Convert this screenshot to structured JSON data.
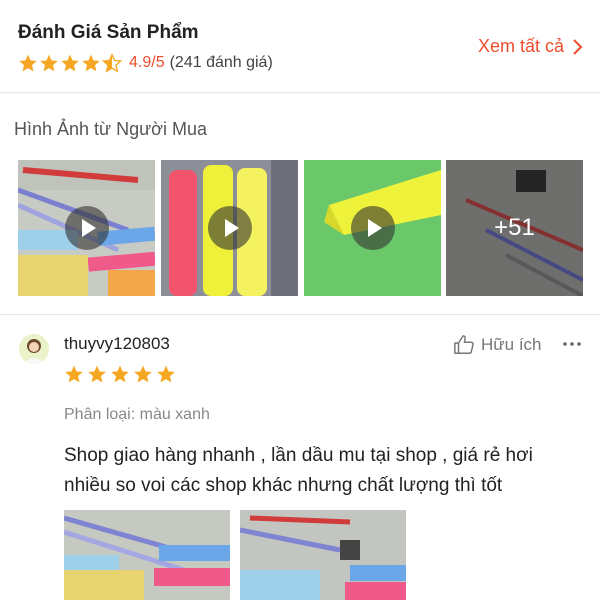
{
  "ratings": {
    "title": "Đánh Giá Sản Phẩm",
    "score": "4.9/5",
    "count": "(241 đánh giá)",
    "star_color": "#f5a623",
    "see_all": "Xem tất cả",
    "accent": "#ee4d2d"
  },
  "buyer_photos": {
    "title": "Hình Ảnh từ Người Mua",
    "items": [
      {
        "kind": "video",
        "icon": "play-icon"
      },
      {
        "kind": "video",
        "icon": "play-icon"
      },
      {
        "kind": "video",
        "icon": "play-icon"
      },
      {
        "kind": "more",
        "label": "+51"
      }
    ]
  },
  "review": {
    "username": "thuyvy120803",
    "stars": 5,
    "helpful_label": "Hữu ích",
    "variation": "Phân loại: màu xanh",
    "text": "Shop giao hàng nhanh , lần dầu mu tại shop , giá rẻ hơi nhiều so voi các shop khác nhưng chất lượng thì tốt",
    "photos": 2
  }
}
